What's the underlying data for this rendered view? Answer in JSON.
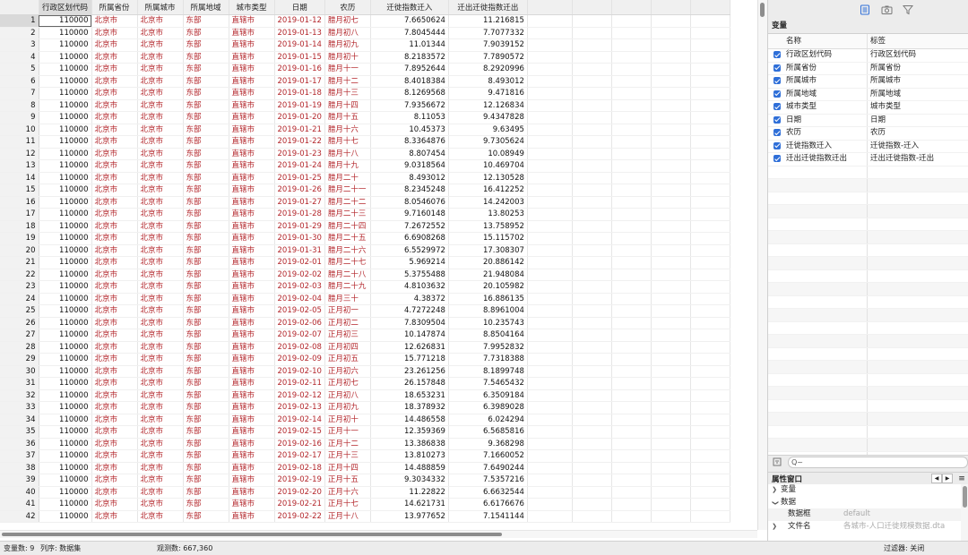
{
  "grid": {
    "columns": [
      "行政区划代码",
      "所属省份",
      "所属城市",
      "所属地域",
      "城市类型",
      "日期",
      "农历",
      "迁徙指数迁入",
      "迁出迁徙指数迁出"
    ],
    "rows": [
      [
        1,
        "110000",
        "北京市",
        "北京市",
        "东部",
        "直辖市",
        "2019-01-12",
        "腊月初七",
        "7.6650624",
        "11.216815"
      ],
      [
        2,
        "110000",
        "北京市",
        "北京市",
        "东部",
        "直辖市",
        "2019-01-13",
        "腊月初八",
        "7.8045444",
        "7.7077332"
      ],
      [
        3,
        "110000",
        "北京市",
        "北京市",
        "东部",
        "直辖市",
        "2019-01-14",
        "腊月初九",
        "11.01344",
        "7.9039152"
      ],
      [
        4,
        "110000",
        "北京市",
        "北京市",
        "东部",
        "直辖市",
        "2019-01-15",
        "腊月初十",
        "8.2183572",
        "7.7890572"
      ],
      [
        5,
        "110000",
        "北京市",
        "北京市",
        "东部",
        "直辖市",
        "2019-01-16",
        "腊月十一",
        "7.8952644",
        "8.2920996"
      ],
      [
        6,
        "110000",
        "北京市",
        "北京市",
        "东部",
        "直辖市",
        "2019-01-17",
        "腊月十二",
        "8.4018384",
        "8.493012"
      ],
      [
        7,
        "110000",
        "北京市",
        "北京市",
        "东部",
        "直辖市",
        "2019-01-18",
        "腊月十三",
        "8.1269568",
        "9.471816"
      ],
      [
        8,
        "110000",
        "北京市",
        "北京市",
        "东部",
        "直辖市",
        "2019-01-19",
        "腊月十四",
        "7.9356672",
        "12.126834"
      ],
      [
        9,
        "110000",
        "北京市",
        "北京市",
        "东部",
        "直辖市",
        "2019-01-20",
        "腊月十五",
        "8.11053",
        "9.4347828"
      ],
      [
        10,
        "110000",
        "北京市",
        "北京市",
        "东部",
        "直辖市",
        "2019-01-21",
        "腊月十六",
        "10.45373",
        "9.63495"
      ],
      [
        11,
        "110000",
        "北京市",
        "北京市",
        "东部",
        "直辖市",
        "2019-01-22",
        "腊月十七",
        "8.3364876",
        "9.7305624"
      ],
      [
        12,
        "110000",
        "北京市",
        "北京市",
        "东部",
        "直辖市",
        "2019-01-23",
        "腊月十八",
        "8.807454",
        "10.08949"
      ],
      [
        13,
        "110000",
        "北京市",
        "北京市",
        "东部",
        "直辖市",
        "2019-01-24",
        "腊月十九",
        "9.0318564",
        "10.469704"
      ],
      [
        14,
        "110000",
        "北京市",
        "北京市",
        "东部",
        "直辖市",
        "2019-01-25",
        "腊月二十",
        "8.493012",
        "12.130528"
      ],
      [
        15,
        "110000",
        "北京市",
        "北京市",
        "东部",
        "直辖市",
        "2019-01-26",
        "腊月二十一",
        "8.2345248",
        "16.412252"
      ],
      [
        16,
        "110000",
        "北京市",
        "北京市",
        "东部",
        "直辖市",
        "2019-01-27",
        "腊月二十二",
        "8.0546076",
        "14.242003"
      ],
      [
        17,
        "110000",
        "北京市",
        "北京市",
        "东部",
        "直辖市",
        "2019-01-28",
        "腊月二十三",
        "9.7160148",
        "13.80253"
      ],
      [
        18,
        "110000",
        "北京市",
        "北京市",
        "东部",
        "直辖市",
        "2019-01-29",
        "腊月二十四",
        "7.2672552",
        "13.758952"
      ],
      [
        19,
        "110000",
        "北京市",
        "北京市",
        "东部",
        "直辖市",
        "2019-01-30",
        "腊月二十五",
        "6.6908268",
        "15.115702"
      ],
      [
        20,
        "110000",
        "北京市",
        "北京市",
        "东部",
        "直辖市",
        "2019-01-31",
        "腊月二十六",
        "6.5529972",
        "17.308307"
      ],
      [
        21,
        "110000",
        "北京市",
        "北京市",
        "东部",
        "直辖市",
        "2019-02-01",
        "腊月二十七",
        "5.969214",
        "20.886142"
      ],
      [
        22,
        "110000",
        "北京市",
        "北京市",
        "东部",
        "直辖市",
        "2019-02-02",
        "腊月二十八",
        "5.3755488",
        "21.948084"
      ],
      [
        23,
        "110000",
        "北京市",
        "北京市",
        "东部",
        "直辖市",
        "2019-02-03",
        "腊月二十九",
        "4.8103632",
        "20.105982"
      ],
      [
        24,
        "110000",
        "北京市",
        "北京市",
        "东部",
        "直辖市",
        "2019-02-04",
        "腊月三十",
        "4.38372",
        "16.886135"
      ],
      [
        25,
        "110000",
        "北京市",
        "北京市",
        "东部",
        "直辖市",
        "2019-02-05",
        "正月初一",
        "4.7272248",
        "8.8961004"
      ],
      [
        26,
        "110000",
        "北京市",
        "北京市",
        "东部",
        "直辖市",
        "2019-02-06",
        "正月初二",
        "7.8309504",
        "10.235743"
      ],
      [
        27,
        "110000",
        "北京市",
        "北京市",
        "东部",
        "直辖市",
        "2019-02-07",
        "正月初三",
        "10.147874",
        "8.8504164"
      ],
      [
        28,
        "110000",
        "北京市",
        "北京市",
        "东部",
        "直辖市",
        "2019-02-08",
        "正月初四",
        "12.626831",
        "7.9952832"
      ],
      [
        29,
        "110000",
        "北京市",
        "北京市",
        "东部",
        "直辖市",
        "2019-02-09",
        "正月初五",
        "15.771218",
        "7.7318388"
      ],
      [
        30,
        "110000",
        "北京市",
        "北京市",
        "东部",
        "直辖市",
        "2019-02-10",
        "正月初六",
        "23.261256",
        "8.1899748"
      ],
      [
        31,
        "110000",
        "北京市",
        "北京市",
        "东部",
        "直辖市",
        "2019-02-11",
        "正月初七",
        "26.157848",
        "7.5465432"
      ],
      [
        32,
        "110000",
        "北京市",
        "北京市",
        "东部",
        "直辖市",
        "2019-02-12",
        "正月初八",
        "18.653231",
        "6.3509184"
      ],
      [
        33,
        "110000",
        "北京市",
        "北京市",
        "东部",
        "直辖市",
        "2019-02-13",
        "正月初九",
        "18.378932",
        "6.3989028"
      ],
      [
        34,
        "110000",
        "北京市",
        "北京市",
        "东部",
        "直辖市",
        "2019-02-14",
        "正月初十",
        "14.486558",
        "6.024294"
      ],
      [
        35,
        "110000",
        "北京市",
        "北京市",
        "东部",
        "直辖市",
        "2019-02-15",
        "正月十一",
        "12.359369",
        "6.5685816"
      ],
      [
        36,
        "110000",
        "北京市",
        "北京市",
        "东部",
        "直辖市",
        "2019-02-16",
        "正月十二",
        "13.386838",
        "9.368298"
      ],
      [
        37,
        "110000",
        "北京市",
        "北京市",
        "东部",
        "直辖市",
        "2019-02-17",
        "正月十三",
        "13.810273",
        "7.1660052"
      ],
      [
        38,
        "110000",
        "北京市",
        "北京市",
        "东部",
        "直辖市",
        "2019-02-18",
        "正月十四",
        "14.488859",
        "7.6490244"
      ],
      [
        39,
        "110000",
        "北京市",
        "北京市",
        "东部",
        "直辖市",
        "2019-02-19",
        "正月十五",
        "9.3034332",
        "7.5357216"
      ],
      [
        40,
        "110000",
        "北京市",
        "北京市",
        "东部",
        "直辖市",
        "2019-02-20",
        "正月十六",
        "11.22822",
        "6.6632544"
      ],
      [
        41,
        "110000",
        "北京市",
        "北京市",
        "东部",
        "直辖市",
        "2019-02-21",
        "正月十七",
        "14.621731",
        "6.6176676"
      ],
      [
        42,
        "110000",
        "北京市",
        "北京市",
        "东部",
        "直辖市",
        "2019-02-22",
        "正月十八",
        "13.977652",
        "7.1541144"
      ]
    ]
  },
  "variables_panel": {
    "title": "变量",
    "headers": {
      "name": "名称",
      "label": "标签"
    },
    "items": [
      {
        "name": "行政区划代码",
        "label": "行政区划代码"
      },
      {
        "name": "所属省份",
        "label": "所属省份"
      },
      {
        "name": "所属城市",
        "label": "所属城市"
      },
      {
        "name": "所属地域",
        "label": "所属地域"
      },
      {
        "name": "城市类型",
        "label": "城市类型"
      },
      {
        "name": "日期",
        "label": "日期"
      },
      {
        "name": "农历",
        "label": "农历"
      },
      {
        "name": "迁徙指数迁入",
        "label": "迁徙指数-迁入"
      },
      {
        "name": "迁出迁徙指数迁出",
        "label": "迁出迁徙指数-迁出"
      }
    ],
    "search_placeholder": "Q~"
  },
  "properties_panel": {
    "title": "属性窗口",
    "nav_prev": "◀",
    "nav_next": "▶",
    "sections": {
      "variables": "变量",
      "data": "数据"
    },
    "rows": [
      {
        "key": "数据框",
        "value": "default"
      },
      {
        "key": "文件名",
        "value": "各城市-人口迁徙规模数据.dta"
      }
    ]
  },
  "status_bar": {
    "vars": "变量数:  9",
    "order": "列序:  数据集",
    "obs": "观测数:  667,360",
    "filter": "过滤器:  关闭"
  },
  "colors": {
    "string_cell": "#b3262b",
    "checkbox": "#2f6fd8"
  }
}
